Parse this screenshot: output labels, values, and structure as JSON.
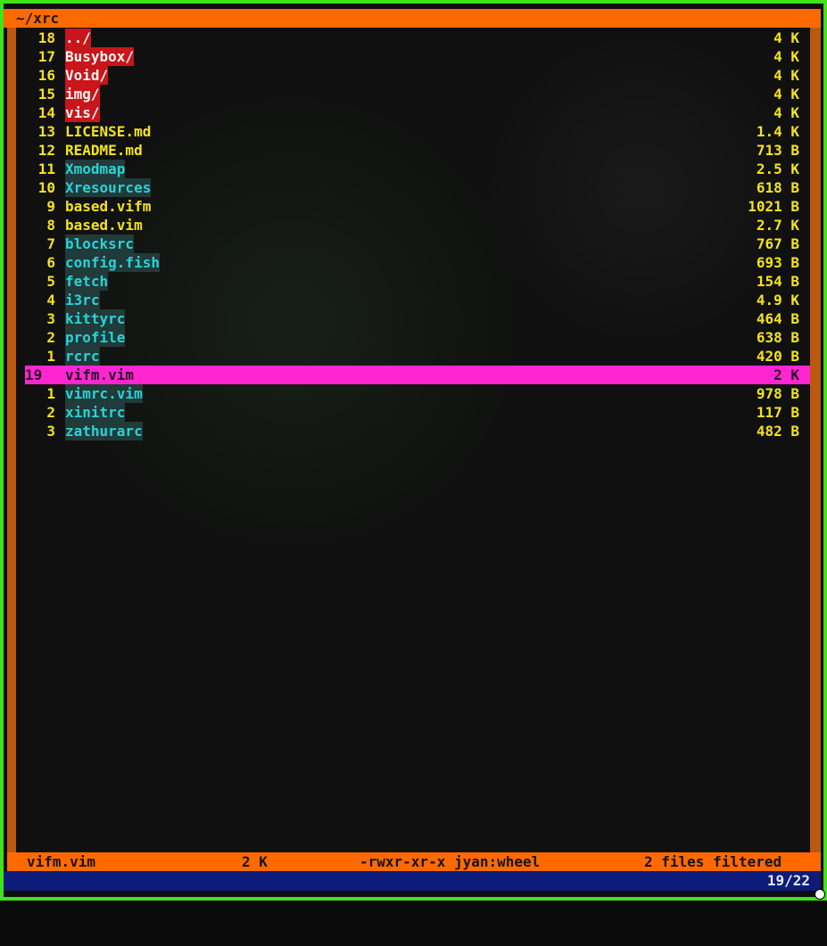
{
  "title": "~/xrc",
  "files": [
    {
      "num": "18",
      "name": "../",
      "size": "4 K",
      "type": "dir"
    },
    {
      "num": "17",
      "name": "Busybox/",
      "size": "4 K",
      "type": "dir"
    },
    {
      "num": "16",
      "name": "Void/",
      "size": "4 K",
      "type": "dir"
    },
    {
      "num": "15",
      "name": "img/",
      "size": "4 K",
      "type": "dir"
    },
    {
      "num": "14",
      "name": "vis/",
      "size": "4 K",
      "type": "dir"
    },
    {
      "num": "13",
      "name": "LICENSE.md",
      "size": "1.4 K",
      "type": "reg"
    },
    {
      "num": "12",
      "name": "README.md",
      "size": "713 B",
      "type": "reg"
    },
    {
      "num": "11",
      "name": "Xmodmap",
      "size": "2.5 K",
      "type": "exe"
    },
    {
      "num": "10",
      "name": "Xresources",
      "size": "618 B",
      "type": "exe"
    },
    {
      "num": "9",
      "name": "based.vifm",
      "size": "1021 B",
      "type": "reg"
    },
    {
      "num": "8",
      "name": "based.vim",
      "size": "2.7 K",
      "type": "reg"
    },
    {
      "num": "7",
      "name": "blocksrc",
      "size": "767 B",
      "type": "exe"
    },
    {
      "num": "6",
      "name": "config.fish",
      "size": "693 B",
      "type": "exe"
    },
    {
      "num": "5",
      "name": "fetch",
      "size": "154 B",
      "type": "exe"
    },
    {
      "num": "4",
      "name": "i3rc",
      "size": "4.9 K",
      "type": "exe"
    },
    {
      "num": "3",
      "name": "kittyrc",
      "size": "464 B",
      "type": "exe"
    },
    {
      "num": "2",
      "name": "profile",
      "size": "638 B",
      "type": "exe"
    },
    {
      "num": "1",
      "name": "rcrc",
      "size": "420 B",
      "type": "exe"
    },
    {
      "num": "19",
      "name": "vifm.vim",
      "size": "2 K",
      "type": "cur"
    },
    {
      "num": "1",
      "name": "vimrc.vim",
      "size": "978 B",
      "type": "exe"
    },
    {
      "num": "2",
      "name": "xinitrc",
      "size": "117 B",
      "type": "exe"
    },
    {
      "num": "3",
      "name": "zathurarc",
      "size": "482 B",
      "type": "exe"
    }
  ],
  "status": {
    "file": "vifm.vim",
    "size": "2 K",
    "perms": "-rwxr-xr-x jyan:wheel",
    "filter": "2 files filtered"
  },
  "position": "19/22",
  "colors": {
    "border": "#3fe21d",
    "bar": "#ff6a00",
    "dir_bg": "#c8161a",
    "cursor": "#ff26d2",
    "exe_fg": "#27d4d8",
    "text": "#f5e31a",
    "cmdline_bg": "#0c1c78"
  }
}
